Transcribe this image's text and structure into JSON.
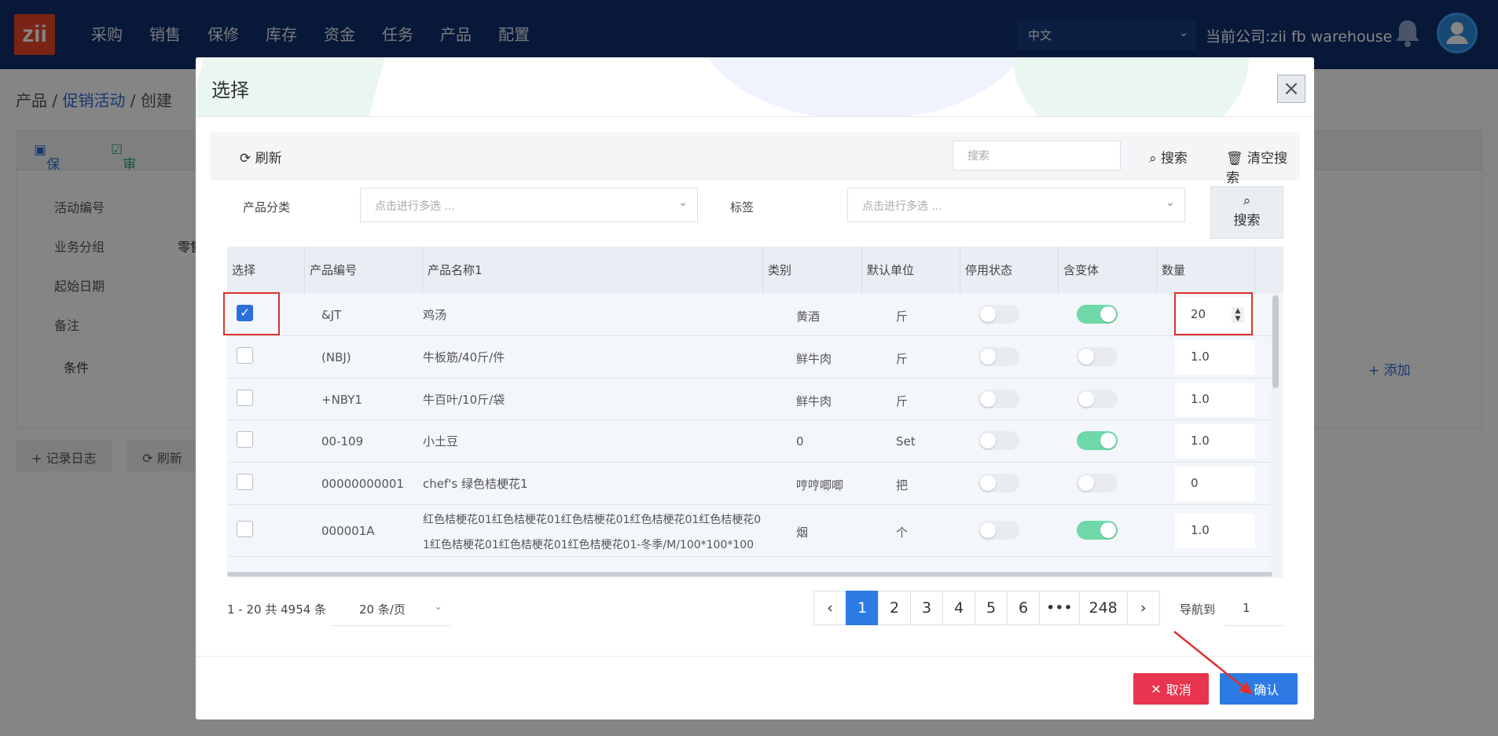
{
  "app": {
    "logo_text": "zii"
  },
  "nav": {
    "menu": [
      "采购",
      "销售",
      "保修",
      "库存",
      "资金",
      "任务",
      "产品",
      "配置"
    ],
    "language": "中文",
    "company": "当前公司:zii fb warehouse"
  },
  "background": {
    "breadcrumb": [
      "产品",
      "促销活动",
      "创建"
    ],
    "toolbar": {
      "save": "保存",
      "audit": "审核"
    },
    "form_labels": [
      "活动编号",
      "业务分组",
      "起始日期",
      "备注"
    ],
    "group_value_partial": "零售",
    "conditions_label": "条件",
    "add_label": "+ 添加",
    "bottom_buttons": [
      "记录日志",
      "刷新"
    ]
  },
  "modal": {
    "title": "选择",
    "toolbar": {
      "refresh": "刷新",
      "search_placeholder": "搜索",
      "search": "搜索",
      "clear_search": "清空搜索"
    },
    "filters": {
      "category_label": "产品分类",
      "category_placeholder": "点击进行多选 ...",
      "tag_label": "标签",
      "tag_placeholder": "点击进行多选 ...",
      "search": "搜索"
    },
    "table": {
      "headers": [
        "选择",
        "产品编号",
        "产品名称1",
        "类别",
        "默认单位",
        "停用状态",
        "含变体",
        "数量"
      ],
      "rows": [
        {
          "checked": true,
          "code": "&JT",
          "name": "鸡汤",
          "name2": "",
          "category": "黄酒",
          "unit": "斤",
          "disabled": false,
          "variant": true,
          "qty": "20"
        },
        {
          "checked": false,
          "code": "(NBJ)",
          "name": "牛板筋/40斤/件",
          "name2": "",
          "category": "鲜牛肉",
          "unit": "斤",
          "disabled": false,
          "variant": false,
          "qty": "1.0"
        },
        {
          "checked": false,
          "code": "+NBY1",
          "name": "牛百叶/10斤/袋",
          "name2": "",
          "category": "鲜牛肉",
          "unit": "斤",
          "disabled": false,
          "variant": false,
          "qty": "1.0"
        },
        {
          "checked": false,
          "code": "00-109",
          "name": "小土豆",
          "name2": "",
          "category": "0",
          "unit": "Set",
          "disabled": false,
          "variant": true,
          "qty": "1.0"
        },
        {
          "checked": false,
          "code": "00000000001",
          "name": "chef's 绿色桔梗花1",
          "name2": "",
          "category": "哼哼唧唧",
          "unit": "把",
          "disabled": false,
          "variant": false,
          "qty": "0"
        },
        {
          "checked": false,
          "code": "000001A",
          "name": "红色桔梗花01红色桔梗花01红色桔梗花01红色桔梗花01红色桔梗花0",
          "name2": "1红色桔梗花01红色桔梗花01红色桔梗花01-冬季/M/100*100*100",
          "category": "烟",
          "unit": "个",
          "disabled": false,
          "variant": true,
          "qty": "1.0"
        }
      ]
    },
    "pagination": {
      "info": "1 - 20 共 4954 条",
      "page_size": "20 条/页",
      "pages": [
        "1",
        "2",
        "3",
        "4",
        "5",
        "6",
        "•••",
        "248"
      ],
      "current": "1",
      "goto_label": "导航到",
      "goto_value": "1"
    },
    "footer": {
      "cancel": "取消",
      "confirm": "确认"
    }
  },
  "colors": {
    "nav_bg": "#0f2f6e",
    "primary": "#2c7be5",
    "danger": "#e8344e",
    "toggle_on": "#6fd8a8",
    "highlight": "#e0312b"
  }
}
